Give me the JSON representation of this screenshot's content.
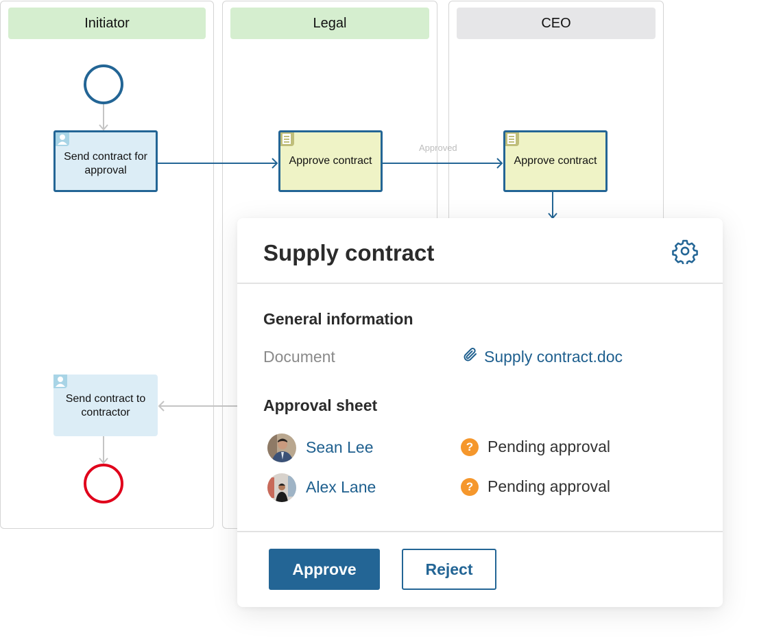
{
  "lanes": [
    {
      "name": "Initiator",
      "status": "active"
    },
    {
      "name": "Legal",
      "status": "active"
    },
    {
      "name": "CEO",
      "status": "inactive"
    }
  ],
  "diagram": {
    "tasks": [
      {
        "label": "Send contract for approval",
        "type": "user-task",
        "state": "highlighted",
        "icon": "user-icon"
      },
      {
        "label": "Approve contract",
        "type": "approval-task",
        "state": "highlighted",
        "icon": "document-icon"
      },
      {
        "label": "Approve contract",
        "type": "approval-task",
        "state": "highlighted",
        "icon": "document-icon"
      },
      {
        "label": "Send contract to contractor",
        "type": "user-task",
        "state": "normal",
        "icon": "user-icon"
      }
    ],
    "flow_label": "Approved",
    "colors": {
      "flow": "#236595",
      "inactive_flow": "#c4c4c4",
      "start_event": "#236595",
      "end_event": "#e0001b"
    }
  },
  "panel": {
    "title": "Supply contract",
    "settings_icon": "gear-icon",
    "general_section": "General information",
    "document_label": "Document",
    "document_link": "Supply contract.doc",
    "approval_section": "Approval sheet",
    "approvers": [
      {
        "name": "Sean Lee",
        "status": "Pending approval"
      },
      {
        "name": "Alex Lane",
        "status": "Pending approval"
      }
    ],
    "approve_label": "Approve",
    "reject_label": "Reject",
    "colors": {
      "accent": "#236595",
      "pending": "#f5972c"
    }
  }
}
